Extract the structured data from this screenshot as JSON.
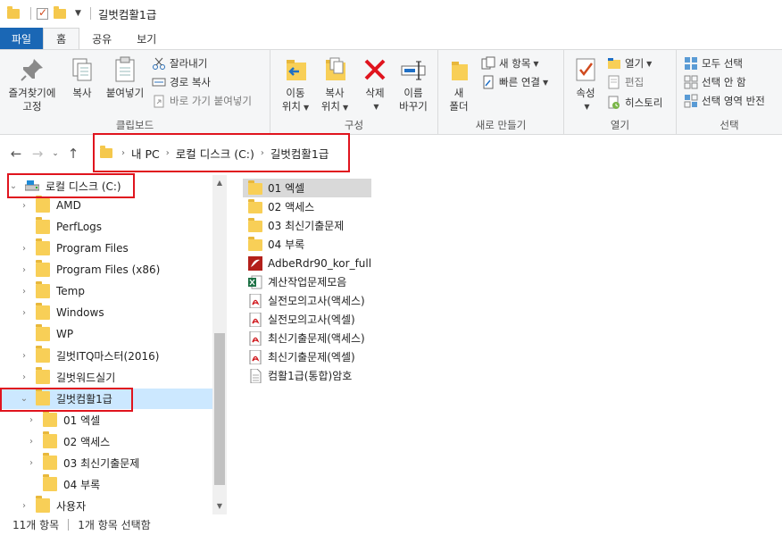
{
  "window": {
    "title": "길벗컴활1급"
  },
  "tabs": [
    {
      "label": "파일"
    },
    {
      "label": "홈"
    },
    {
      "label": "공유"
    },
    {
      "label": "보기"
    }
  ],
  "ribbon": {
    "clipboard": {
      "label": "클립보드",
      "pin": "즐겨찾기에 고정",
      "pin_line1": "즐겨찾기에",
      "pin_line2": "고정",
      "copy": "복사",
      "paste": "붙여넣기",
      "cut": "잘라내기",
      "copy_path": "경로 복사",
      "paste_shortcut": "바로 가기 붙여넣기"
    },
    "organize": {
      "label": "구성",
      "move_to_line1": "이동",
      "move_to_line2": "위치",
      "copy_to_line1": "복사",
      "copy_to_line2": "위치",
      "delete": "삭제",
      "rename_line1": "이름",
      "rename_line2": "바꾸기"
    },
    "new": {
      "label": "새로 만들기",
      "new_folder_line1": "새",
      "new_folder_line2": "폴더",
      "new_item": "새 항목",
      "easy_access": "빠른 연결"
    },
    "open": {
      "label": "열기",
      "properties": "속성",
      "open": "열기",
      "edit": "편집",
      "history": "히스토리"
    },
    "select": {
      "label": "선택",
      "select_all": "모두 선택",
      "select_none": "선택 안 함",
      "invert": "선택 영역 반전"
    }
  },
  "address": {
    "crumbs": [
      "내 PC",
      "로컬 디스크 (C:)",
      "길벗컴활1급"
    ]
  },
  "tree": {
    "root": "로컬 디스크 (C:)",
    "items": [
      "AMD",
      "PerfLogs",
      "Program Files",
      "Program Files (x86)",
      "Temp",
      "Windows",
      "WP",
      "길벗ITQ마스터(2016)",
      "길벗워드실기",
      "길벗컴활1급",
      "01 엑셀",
      "02 액세스",
      "03 최신기출문제",
      "04 부록",
      "사용자"
    ]
  },
  "files": [
    {
      "name": "01 엑셀",
      "icon": "folder-icon"
    },
    {
      "name": "02 액세스",
      "icon": "folder-icon"
    },
    {
      "name": "03 최신기출문제",
      "icon": "folder-icon"
    },
    {
      "name": "04 부록",
      "icon": "folder-icon"
    },
    {
      "name": "AdbeRdr90_kor_full",
      "icon": "installer-icon"
    },
    {
      "name": "계산작업문제모음",
      "icon": "excel-icon"
    },
    {
      "name": "실전모의고사(액세스)",
      "icon": "pdf-icon"
    },
    {
      "name": "실전모의고사(엑셀)",
      "icon": "pdf-icon"
    },
    {
      "name": "최신기출문제(액세스)",
      "icon": "pdf-icon"
    },
    {
      "name": "최신기출문제(엑셀)",
      "icon": "pdf-icon"
    },
    {
      "name": "컴활1급(통합)암호",
      "icon": "text-file-icon"
    }
  ],
  "status": {
    "item_count": "11개 항목",
    "selected": "1개 항목 선택함"
  }
}
